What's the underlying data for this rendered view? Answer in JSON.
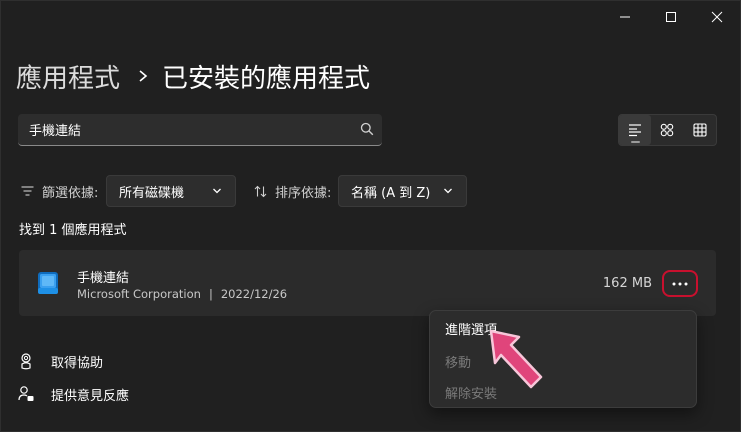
{
  "window": {
    "minimize_icon": "minimize-icon",
    "maximize_icon": "maximize-icon",
    "close_icon": "close-icon"
  },
  "breadcrumb": {
    "parent": "應用程式",
    "separator_icon": "chevron-right-icon",
    "current": "已安裝的應用程式"
  },
  "search": {
    "value": "手機連結",
    "icon": "search-icon"
  },
  "view_modes": {
    "icons": [
      "list-view-icon",
      "tile-view-icon",
      "grid-view-icon"
    ],
    "selected": "list"
  },
  "filter": {
    "label": "篩選依據:",
    "value": "所有磁碟機",
    "icon": "filter-icon"
  },
  "sort": {
    "label": "排序依據:",
    "value": "名稱 (A 到 Z)",
    "icon": "sort-icon"
  },
  "results": {
    "found_text": "找到 1 個應用程式"
  },
  "apps": [
    {
      "name": "手機連結",
      "publisher": "Microsoft Corporation",
      "separator": "|",
      "date": "2022/12/26",
      "size": "162 MB",
      "icon": "phone-link-app-icon",
      "more_icon": "more-options-icon"
    }
  ],
  "context_menu": {
    "items": [
      {
        "label": "進階選項",
        "enabled": true
      },
      {
        "label": "移動",
        "enabled": false
      },
      {
        "label": "解除安裝",
        "enabled": false
      }
    ]
  },
  "footer_links": [
    {
      "label": "取得協助",
      "icon": "help-icon"
    },
    {
      "label": "提供意見反應",
      "icon": "feedback-icon"
    }
  ],
  "colors": {
    "background": "#202020",
    "card": "#2b2b2b",
    "highlight_outline": "#c8102e",
    "pointer_arrow": "#e0457b",
    "app_icon_blue": "#1e90e6"
  }
}
